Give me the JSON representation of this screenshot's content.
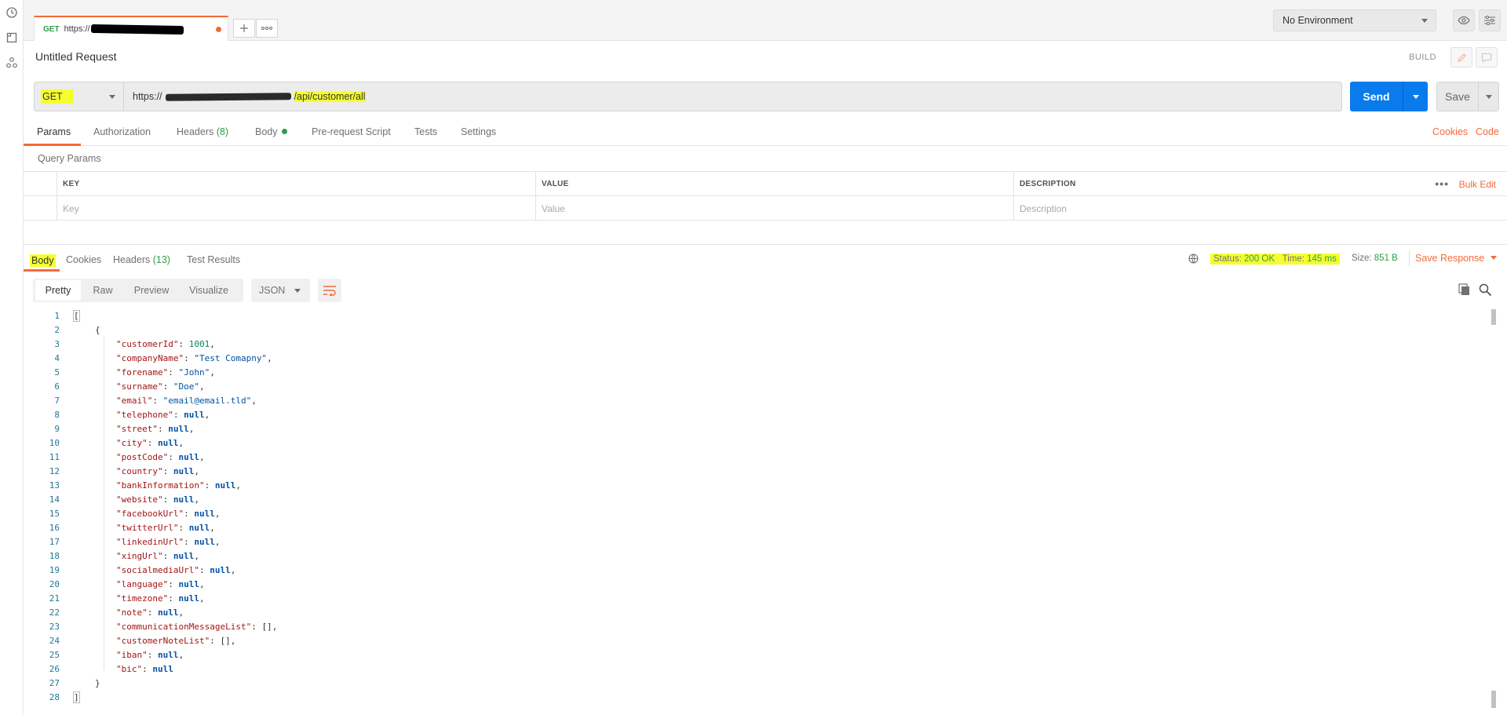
{
  "tab": {
    "method": "GET",
    "url_prefix": "https://"
  },
  "environment": {
    "selected": "No Environment"
  },
  "request": {
    "name": "Untitled Request",
    "mode_label": "BUILD",
    "method": "GET",
    "url_prefix": "https://",
    "url_path": "/api/customer/all"
  },
  "buttons": {
    "send": "Send",
    "save": "Save"
  },
  "request_tabs": [
    {
      "label": "Params"
    },
    {
      "label": "Authorization"
    },
    {
      "label": "Headers",
      "count": "(8)"
    },
    {
      "label": "Body"
    },
    {
      "label": "Pre-request Script"
    },
    {
      "label": "Tests"
    },
    {
      "label": "Settings"
    }
  ],
  "links": {
    "cookies": "Cookies",
    "code": "Code"
  },
  "params": {
    "title": "Query Params",
    "headers": [
      "KEY",
      "VALUE",
      "DESCRIPTION"
    ],
    "placeholders": [
      "Key",
      "Value",
      "Description"
    ],
    "bulk_edit": "Bulk Edit",
    "more": "•••"
  },
  "response": {
    "tabs": [
      {
        "label": "Body"
      },
      {
        "label": "Cookies"
      },
      {
        "label": "Headers",
        "count": "(13)"
      },
      {
        "label": "Test Results"
      }
    ],
    "status_label": "Status:",
    "status_value": "200 OK",
    "time_label": "Time:",
    "time_value": "145 ms",
    "size_label": "Size:",
    "size_value": "851 B",
    "save_response": "Save Response",
    "views": [
      "Pretty",
      "Raw",
      "Preview",
      "Visualize"
    ],
    "format": "JSON"
  },
  "code_lines": [
    {
      "n": "1",
      "indent": 0,
      "parts": [
        [
          "br",
          "["
        ]
      ],
      "box": true
    },
    {
      "n": "2",
      "indent": 1,
      "parts": [
        [
          "br",
          "{"
        ]
      ]
    },
    {
      "n": "3",
      "indent": 2,
      "parts": [
        [
          "k",
          "\"customerId\""
        ],
        [
          "p",
          ": "
        ],
        [
          "nv",
          "1001"
        ],
        [
          "p",
          ","
        ]
      ]
    },
    {
      "n": "4",
      "indent": 2,
      "parts": [
        [
          "k",
          "\"companyName\""
        ],
        [
          "p",
          ": "
        ],
        [
          "sv",
          "\"Test Comapny\""
        ],
        [
          "p",
          ","
        ]
      ]
    },
    {
      "n": "5",
      "indent": 2,
      "parts": [
        [
          "k",
          "\"forename\""
        ],
        [
          "p",
          ": "
        ],
        [
          "sv",
          "\"John\""
        ],
        [
          "p",
          ","
        ]
      ]
    },
    {
      "n": "6",
      "indent": 2,
      "parts": [
        [
          "k",
          "\"surname\""
        ],
        [
          "p",
          ": "
        ],
        [
          "sv",
          "\"Doe\""
        ],
        [
          "p",
          ","
        ]
      ]
    },
    {
      "n": "7",
      "indent": 2,
      "parts": [
        [
          "k",
          "\"email\""
        ],
        [
          "p",
          ": "
        ],
        [
          "sv",
          "\"email@email.tld\""
        ],
        [
          "p",
          ","
        ]
      ]
    },
    {
      "n": "8",
      "indent": 2,
      "parts": [
        [
          "k",
          "\"telephone\""
        ],
        [
          "p",
          ": "
        ],
        [
          "nl",
          "null"
        ],
        [
          "p",
          ","
        ]
      ]
    },
    {
      "n": "9",
      "indent": 2,
      "parts": [
        [
          "k",
          "\"street\""
        ],
        [
          "p",
          ": "
        ],
        [
          "nl",
          "null"
        ],
        [
          "p",
          ","
        ]
      ]
    },
    {
      "n": "10",
      "indent": 2,
      "parts": [
        [
          "k",
          "\"city\""
        ],
        [
          "p",
          ": "
        ],
        [
          "nl",
          "null"
        ],
        [
          "p",
          ","
        ]
      ]
    },
    {
      "n": "11",
      "indent": 2,
      "parts": [
        [
          "k",
          "\"postCode\""
        ],
        [
          "p",
          ": "
        ],
        [
          "nl",
          "null"
        ],
        [
          "p",
          ","
        ]
      ]
    },
    {
      "n": "12",
      "indent": 2,
      "parts": [
        [
          "k",
          "\"country\""
        ],
        [
          "p",
          ": "
        ],
        [
          "nl",
          "null"
        ],
        [
          "p",
          ","
        ]
      ]
    },
    {
      "n": "13",
      "indent": 2,
      "parts": [
        [
          "k",
          "\"bankInformation\""
        ],
        [
          "p",
          ": "
        ],
        [
          "nl",
          "null"
        ],
        [
          "p",
          ","
        ]
      ]
    },
    {
      "n": "14",
      "indent": 2,
      "parts": [
        [
          "k",
          "\"website\""
        ],
        [
          "p",
          ": "
        ],
        [
          "nl",
          "null"
        ],
        [
          "p",
          ","
        ]
      ]
    },
    {
      "n": "15",
      "indent": 2,
      "parts": [
        [
          "k",
          "\"facebookUrl\""
        ],
        [
          "p",
          ": "
        ],
        [
          "nl",
          "null"
        ],
        [
          "p",
          ","
        ]
      ]
    },
    {
      "n": "16",
      "indent": 2,
      "parts": [
        [
          "k",
          "\"twitterUrl\""
        ],
        [
          "p",
          ": "
        ],
        [
          "nl",
          "null"
        ],
        [
          "p",
          ","
        ]
      ]
    },
    {
      "n": "17",
      "indent": 2,
      "parts": [
        [
          "k",
          "\"linkedinUrl\""
        ],
        [
          "p",
          ": "
        ],
        [
          "nl",
          "null"
        ],
        [
          "p",
          ","
        ]
      ]
    },
    {
      "n": "18",
      "indent": 2,
      "parts": [
        [
          "k",
          "\"xingUrl\""
        ],
        [
          "p",
          ": "
        ],
        [
          "nl",
          "null"
        ],
        [
          "p",
          ","
        ]
      ]
    },
    {
      "n": "19",
      "indent": 2,
      "parts": [
        [
          "k",
          "\"socialmediaUrl\""
        ],
        [
          "p",
          ": "
        ],
        [
          "nl",
          "null"
        ],
        [
          "p",
          ","
        ]
      ]
    },
    {
      "n": "20",
      "indent": 2,
      "parts": [
        [
          "k",
          "\"language\""
        ],
        [
          "p",
          ": "
        ],
        [
          "nl",
          "null"
        ],
        [
          "p",
          ","
        ]
      ]
    },
    {
      "n": "21",
      "indent": 2,
      "parts": [
        [
          "k",
          "\"timezone\""
        ],
        [
          "p",
          ": "
        ],
        [
          "nl",
          "null"
        ],
        [
          "p",
          ","
        ]
      ]
    },
    {
      "n": "22",
      "indent": 2,
      "parts": [
        [
          "k",
          "\"note\""
        ],
        [
          "p",
          ": "
        ],
        [
          "nl",
          "null"
        ],
        [
          "p",
          ","
        ]
      ]
    },
    {
      "n": "23",
      "indent": 2,
      "parts": [
        [
          "k",
          "\"communicationMessageList\""
        ],
        [
          "p",
          ": "
        ],
        [
          "br",
          "[]"
        ],
        [
          "p",
          ","
        ]
      ]
    },
    {
      "n": "24",
      "indent": 2,
      "parts": [
        [
          "k",
          "\"customerNoteList\""
        ],
        [
          "p",
          ": "
        ],
        [
          "br",
          "[]"
        ],
        [
          "p",
          ","
        ]
      ]
    },
    {
      "n": "25",
      "indent": 2,
      "parts": [
        [
          "k",
          "\"iban\""
        ],
        [
          "p",
          ": "
        ],
        [
          "nl",
          "null"
        ],
        [
          "p",
          ","
        ]
      ]
    },
    {
      "n": "26",
      "indent": 2,
      "parts": [
        [
          "k",
          "\"bic\""
        ],
        [
          "p",
          ": "
        ],
        [
          "nl",
          "null"
        ]
      ]
    },
    {
      "n": "27",
      "indent": 1,
      "parts": [
        [
          "br",
          "}"
        ]
      ]
    },
    {
      "n": "28",
      "indent": 0,
      "parts": [
        [
          "br",
          "]"
        ]
      ],
      "box": true
    }
  ],
  "colors": {
    "accent": "#f26b3a",
    "send_blue": "#097bed",
    "success_green": "#2f9e44",
    "highlight": "#f6ff2e"
  }
}
